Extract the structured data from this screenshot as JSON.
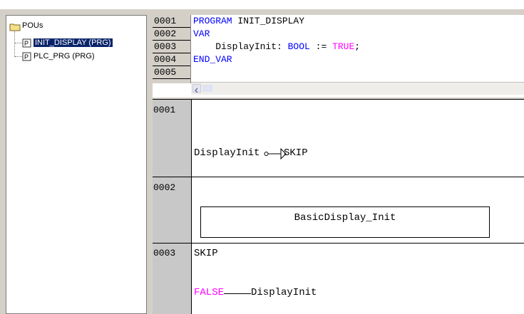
{
  "tree": {
    "root_label": "POUs",
    "items": [
      {
        "label": "INIT_DISPLAY (PRG)",
        "selected": true
      },
      {
        "label": "PLC_PRG (PRG)",
        "selected": false
      }
    ]
  },
  "declaration": {
    "lines": [
      {
        "num": "0001",
        "segments": [
          {
            "t": "PROGRAM ",
            "c": "kw"
          },
          {
            "t": "INIT_DISPLAY",
            "c": ""
          }
        ]
      },
      {
        "num": "0002",
        "segments": [
          {
            "t": "VAR",
            "c": "kw"
          }
        ]
      },
      {
        "num": "0003",
        "segments": [
          {
            "t": "    DisplayInit: ",
            "c": ""
          },
          {
            "t": "BOOL",
            "c": "kw"
          },
          {
            "t": " := ",
            "c": ""
          },
          {
            "t": "TRUE",
            "c": "mag"
          },
          {
            "t": ";",
            "c": ""
          }
        ]
      },
      {
        "num": "0004",
        "segments": [
          {
            "t": "END_VAR",
            "c": "kw"
          }
        ]
      },
      {
        "num": "0005",
        "segments": []
      }
    ]
  },
  "networks": [
    {
      "num": "0001",
      "label": "",
      "contact": "DisplayInit",
      "target": "SKIP"
    },
    {
      "num": "0002",
      "label": "",
      "box": "BasicDisplay_Init"
    },
    {
      "num": "0003",
      "label": "SKIP",
      "const": "FALSE",
      "target": "DisplayInit"
    }
  ],
  "colors": {
    "keyword": "#0000ff",
    "literal": "#ff00ff",
    "selection": "#0a246a"
  }
}
